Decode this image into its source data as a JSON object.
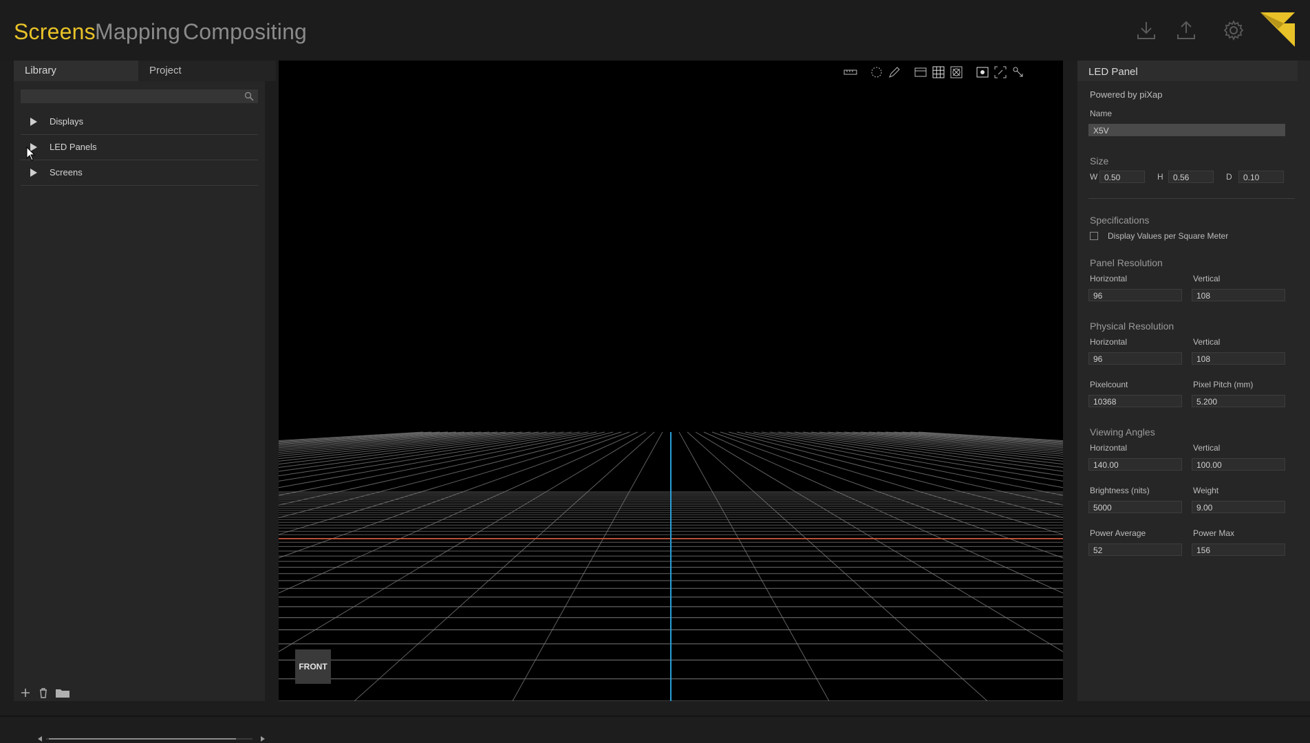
{
  "nav": {
    "tabs": [
      {
        "label": "Screens",
        "active": true
      },
      {
        "label": "Mapping",
        "active": false
      },
      {
        "label": "Compositing",
        "active": false
      }
    ],
    "icons": [
      "download-icon",
      "upload-icon",
      "gear-icon"
    ],
    "accent_color": "#e8c228"
  },
  "library": {
    "tabs": [
      "Library",
      "Project"
    ],
    "search": {
      "value": "",
      "placeholder": ""
    },
    "items": [
      {
        "label": "Displays"
      },
      {
        "label": "LED Panels"
      },
      {
        "label": "Screens"
      }
    ],
    "bottom_icons": [
      "add-icon",
      "trash-icon",
      "folder-icon"
    ]
  },
  "viewport": {
    "toolbar_icons": [
      "ruler-icon",
      "lasso-icon",
      "pencil-icon",
      "panel-icon",
      "grid-icon",
      "target-icon",
      "image-icon",
      "frame-icon",
      "hierarchy-icon"
    ],
    "view_label": "FRONT",
    "axis_colors": {
      "x": "#e05a3a",
      "z": "#2a9fd8",
      "grid": "#808080"
    }
  },
  "inspector": {
    "title": "LED Panel",
    "powered_by": "Powered by piXap",
    "name_label": "Name",
    "name_value": "X5V",
    "size": {
      "label": "Size",
      "w_label": "W",
      "w_value": "0.50",
      "h_label": "H",
      "h_value": "0.56",
      "d_label": "D",
      "d_value": "0.10"
    },
    "specifications_label": "Specifications",
    "display_per_sqm_label": "Display Values per Square Meter",
    "display_per_sqm_checked": false,
    "panel_resolution": {
      "label": "Panel Resolution",
      "horizontal_label": "Horizontal",
      "horizontal_value": "96",
      "vertical_label": "Vertical",
      "vertical_value": "108"
    },
    "physical_resolution": {
      "label": "Physical Resolution",
      "horizontal_label": "Horizontal",
      "horizontal_value": "96",
      "vertical_label": "Vertical",
      "vertical_value": "108"
    },
    "pixelcount_label": "Pixelcount",
    "pixelcount_value": "10368",
    "pixel_pitch_label": "Pixel Pitch (mm)",
    "pixel_pitch_value": "5.200",
    "viewing_angles": {
      "label": "Viewing Angles",
      "horizontal_label": "Horizontal",
      "horizontal_value": "140.00",
      "vertical_label": "Vertical",
      "vertical_value": "100.00"
    },
    "brightness_label": "Brightness (nits)",
    "brightness_value": "5000",
    "weight_label": "Weight",
    "weight_value": "9.00",
    "power_average_label": "Power Average",
    "power_average_value": "52",
    "power_max_label": "Power Max",
    "power_max_value": "156"
  }
}
